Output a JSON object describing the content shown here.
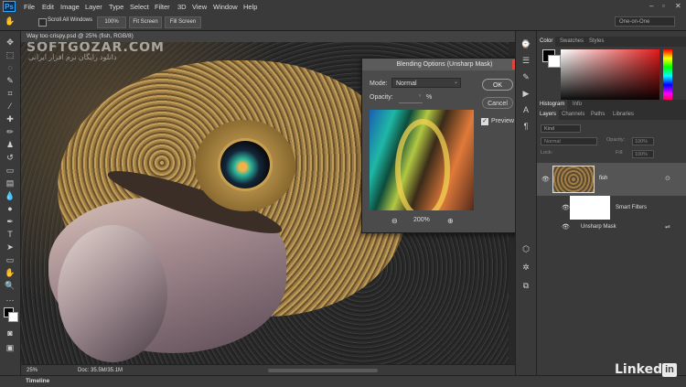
{
  "app": {
    "logo": "Ps",
    "menu": [
      "File",
      "Edit",
      "Image",
      "Layer",
      "Type",
      "Select",
      "Filter",
      "3D",
      "View",
      "Window",
      "Help"
    ]
  },
  "options_bar": {
    "scroll_all_windows": "Scroll All Windows",
    "zoom_value": "100%",
    "fit_screen": "Fit Screen",
    "fill_screen": "Fill Screen",
    "workspace": "One-on-One"
  },
  "document": {
    "tab_label": "Way too crispy.psd @ 25% (fish, RGB/8)",
    "watermark_title": "SOFTGOZAR.COM",
    "watermark_subtitle": "دانلود رایگان نرم افزار ایرانی",
    "zoom": "25%",
    "doc_size": "Doc: 35.5M/35.1M"
  },
  "dialog": {
    "title": "Blending Options (Unsharp Mask)",
    "mode_label": "Mode:",
    "mode_value": "Normal",
    "opacity_label": "Opacity:",
    "opacity_value": "",
    "opacity_unit": "%",
    "ok": "OK",
    "cancel": "Cancel",
    "preview_label": "Preview",
    "preview_checked": "✓",
    "zoom_level": "200%"
  },
  "panels": {
    "color_tabs": [
      "Color",
      "Swatches",
      "Styles"
    ],
    "history_tabs": [
      "Histogram",
      "Info"
    ],
    "layer_tabs": [
      "Layers",
      "Channels",
      "Paths",
      "Libraries"
    ],
    "kind_filter": "Kind",
    "blend_mode": "Normal",
    "opacity_label": "Opacity:",
    "opacity_value": "100%",
    "lock_label": "Lock:",
    "fill_label": "Fill:",
    "fill_value": "100%",
    "layers": [
      {
        "name": "fish"
      },
      {
        "name": "Smart Filters"
      },
      {
        "name": "Unsharp Mask"
      }
    ]
  },
  "timeline": {
    "label": "Timeline"
  },
  "branding": {
    "linkedin": "Linked",
    "linkedin_in": "in"
  },
  "colors": {
    "accent": "#31a8ff",
    "close": "#e2433a"
  }
}
